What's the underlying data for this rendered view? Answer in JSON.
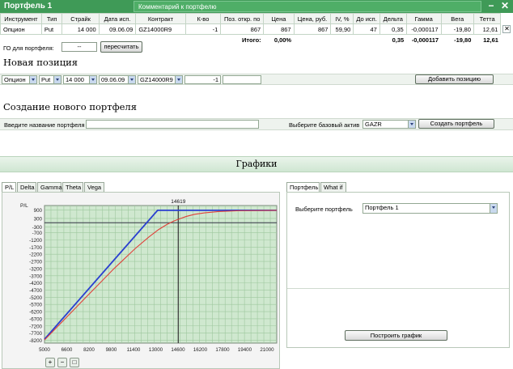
{
  "window": {
    "title": "Портфель 1",
    "comment_placeholder": "Комментарий к портфелю",
    "minimize": "−",
    "close": "✕"
  },
  "table": {
    "headers": [
      "Инструмент",
      "Тип",
      "Страйк",
      "Дата исп.",
      "Контракт",
      "К-во",
      "Поз. откр. по",
      "Цена",
      "Цена, руб.",
      "IV, %",
      "До исп.",
      "Дельта",
      "Гамма",
      "Вега",
      "Тетта"
    ],
    "row": [
      "Опцион",
      "Put",
      "14 000",
      "09.06.09",
      "GZ14000R9",
      "-1",
      "867",
      "867",
      "867",
      "59,90",
      "47",
      "0,35",
      "-0,000117",
      "-19,80",
      "12,61"
    ],
    "total_label": "Итого:",
    "total_values": {
      "price": "0,00%",
      "delta": "0,35",
      "gamma": "-0,000117",
      "vega": "-19,80",
      "theta": "12,61"
    },
    "remove_row": "✕"
  },
  "go": {
    "label": "ГО для портфеля:",
    "value": "--",
    "recalc_button": "пересчитать"
  },
  "new_position": {
    "title": "Новая позиция",
    "instrument": "Опцион",
    "type": "Put",
    "strike": "14 000",
    "date": "09.06.09",
    "contract": "GZ14000R9",
    "qty": "-1",
    "add_button": "Добавить позицию"
  },
  "new_portfolio": {
    "title": "Создание нового портфеля",
    "name_label": "Введите название портфеля",
    "asset_label": "Выберите базовый актив",
    "asset_value": "GAZR",
    "create_button": "Создать портфель"
  },
  "charts_title": "Графики",
  "chart_tabs": [
    "P/L",
    "Delta",
    "Gamma",
    "Theta",
    "Vega"
  ],
  "right_tabs": [
    "Портфель",
    "What if"
  ],
  "right_panel": {
    "select_label": "Выберите портфель",
    "select_value": "Портфель 1",
    "build_button": "Построить график"
  },
  "zoom_buttons": [
    "+",
    "−",
    "□"
  ],
  "colors": {
    "accent": "#3f9a57",
    "expiry_line": "#2a3fd0",
    "theory_line": "#e0403a",
    "plot_bg": "#cfe8cf"
  },
  "chart_data": {
    "type": "line",
    "ylabel": "P/L",
    "marker_label": "14619",
    "marker_x": 14619,
    "xticks": [
      5000,
      6600,
      8200,
      9800,
      11400,
      13000,
      14600,
      16200,
      17800,
      19400,
      21000
    ],
    "yticks": [
      900,
      300,
      -300,
      -700,
      -1200,
      -1700,
      -2200,
      -2700,
      -3200,
      -3700,
      -4200,
      -4700,
      -5200,
      -5700,
      -6200,
      -6700,
      -7200,
      -7700,
      -8200
    ],
    "xlim": [
      5000,
      21700
    ],
    "ylim": [
      -8400,
      1200
    ],
    "series": [
      {
        "x": [
          5000,
          13133,
          21700
        ],
        "y": [
          -8133,
          867,
          867
        ]
      },
      {
        "x": [
          5000,
          8000,
          10000,
          11500,
          12500,
          13200,
          13800,
          14300,
          14700,
          15200,
          15800,
          16500,
          17500,
          19000,
          21700
        ],
        "y": [
          -8180,
          -5180,
          -3200,
          -1820,
          -1000,
          -480,
          -120,
          120,
          270,
          440,
          590,
          690,
          780,
          840,
          862
        ]
      }
    ],
    "grid": true
  }
}
